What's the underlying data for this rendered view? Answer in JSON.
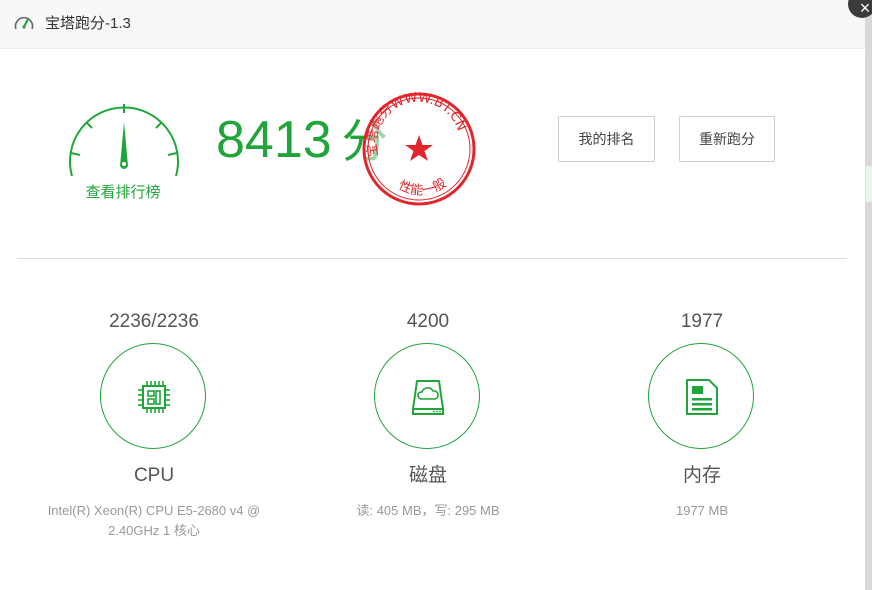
{
  "window": {
    "title": "宝塔跑分-1.3",
    "close_label": "×"
  },
  "score": {
    "value": "8413",
    "unit": "分",
    "leaderboard_link": "查看排行榜"
  },
  "stamp": {
    "text_top": "宝塔跑分WWW.BT.CN",
    "text_bottom": "性能一般",
    "color": "#e0262b"
  },
  "buttons": {
    "my_rank": "我的排名",
    "rerun": "重新跑分"
  },
  "metrics": [
    {
      "value": "2236/2236",
      "name": "CPU",
      "detail": "Intel(R) Xeon(R) CPU E5-2680 v4 @ 2.40GHz 1 核心",
      "icon": "cpu-chip-icon"
    },
    {
      "value": "4200",
      "name": "磁盘",
      "detail": "读: 405 MB，写: 295 MB",
      "icon": "disk-cloud-icon"
    },
    {
      "value": "1977",
      "name": "内存",
      "detail": "1977 MB",
      "icon": "memory-document-icon"
    }
  ],
  "colors": {
    "accent": "#20a53a",
    "stamp_red": "#e0262b"
  }
}
